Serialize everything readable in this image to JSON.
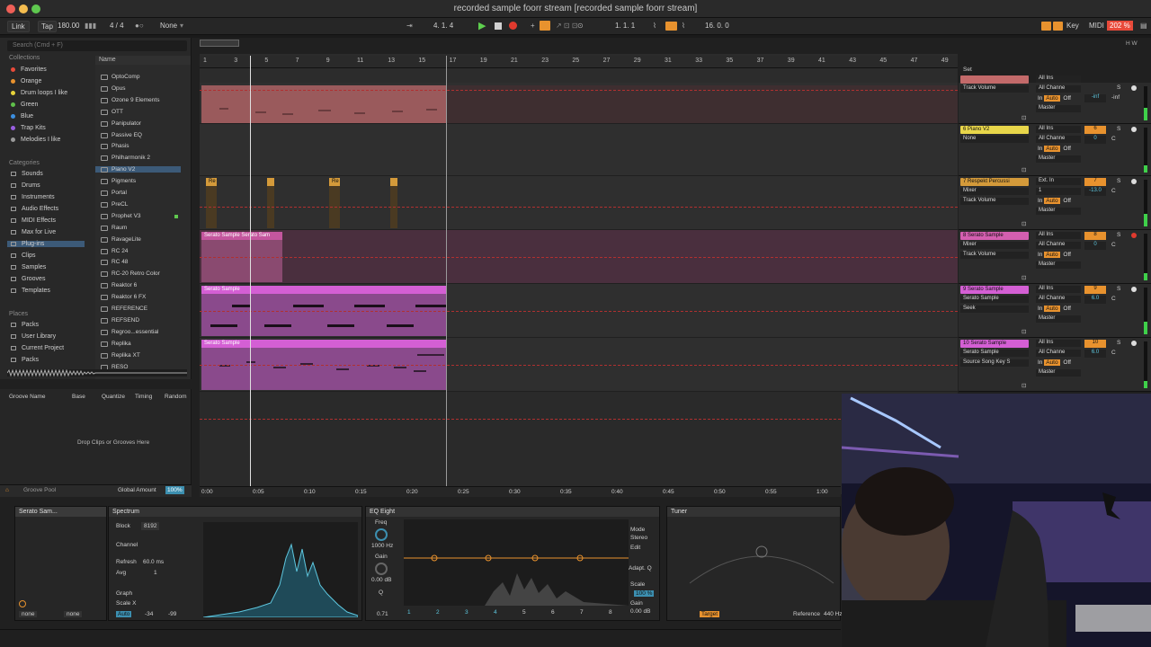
{
  "title": "recorded sample foorr stream  [recorded sample foorr stream]",
  "transport": {
    "link": "Link",
    "tap": "Tap",
    "bpm": "180.00",
    "signature": "4 / 4",
    "quantize": "None",
    "position": "4.   1.   4",
    "loop_start": "1.   1.   1",
    "loop_length": "16.   0.   0",
    "key": "Key",
    "midi": "MIDI",
    "cpu": "202 %"
  },
  "browser": {
    "search_placeholder": "Search (Cmd + F)",
    "collections_header": "Collections",
    "collections": [
      {
        "label": "Favorites",
        "color": "#e84a3a"
      },
      {
        "label": "Orange",
        "color": "#e8922e"
      },
      {
        "label": "Drum loops I like",
        "color": "#e6d23a"
      },
      {
        "label": "Green",
        "color": "#5fc04a"
      },
      {
        "label": "Blue",
        "color": "#3c8fe0"
      },
      {
        "label": "Trap Kits",
        "color": "#9a5fe0"
      },
      {
        "label": "Melodies I like",
        "color": "#9a9a9a"
      }
    ],
    "categories_header": "Categories",
    "categories": [
      "Sounds",
      "Drums",
      "Instruments",
      "Audio Effects",
      "MIDI Effects",
      "Max for Live",
      "Plug-ins",
      "Clips",
      "Samples",
      "Grooves",
      "Templates"
    ],
    "places_header": "Places",
    "places": [
      "Packs",
      "User Library",
      "Current Project",
      "Packs"
    ],
    "name_header": "Name",
    "files": [
      "OptoComp",
      "Opus",
      "Ozone 9 Elements",
      "OTT",
      "Panipulator",
      "Passive EQ",
      "Phasis",
      "Philharmonik 2",
      "Piano V2",
      "Pigments",
      "Portal",
      "PreCL",
      "Prophet V3",
      "Raum",
      "RavageLite",
      "RC 24",
      "RC 48",
      "RC-20 Retro Color",
      "Reaktor 6",
      "Reaktor 6 FX",
      "REFERENCE",
      "REFSEND",
      "Regroo...essential",
      "Replika",
      "Replika XT",
      "RESO"
    ]
  },
  "groove": {
    "name": "Groove Name",
    "base": "Base",
    "quantize": "Quantize",
    "timing": "Timing",
    "random": "Random",
    "drop_text": "Drop Clips or Grooves Here",
    "pool": "Groove Pool",
    "global_amount": "Global Amount",
    "global_value": "100%"
  },
  "ruler": [
    "1",
    "3",
    "5",
    "7",
    "9",
    "11",
    "13",
    "15",
    "17",
    "19",
    "21",
    "23",
    "25",
    "27",
    "29",
    "31",
    "33",
    "35",
    "37",
    "39",
    "41",
    "43",
    "45",
    "47",
    "49"
  ],
  "set_label": "Set",
  "clips": {
    "perc": "Re",
    "serato_long": "Serato Sample Serato Sam",
    "serato_a": "Serato Sample",
    "serato_b": "Serato Sample"
  },
  "tracks": [
    {
      "name": "",
      "sel1": "Track Volume",
      "io1": "All Ins",
      "io2": "All Channe",
      "out": "Master",
      "num": "",
      "vol": "-inf",
      "pan": "-inf",
      "name_color": "#c36a6a"
    },
    {
      "name": "6 Piano V2",
      "sel1": "None",
      "io1": "All Ins",
      "io2": "All Channe",
      "out": "Master",
      "num": "6",
      "vol": "0",
      "pan": "C",
      "name_color": "#e8d64a"
    },
    {
      "name": "7 Respekt Percussi",
      "sel1": "Mixer",
      "sel2": "Track Volume",
      "io1": "Ext. In",
      "io2": "1",
      "out": "Master",
      "num": "7",
      "vol": "-13.0",
      "pan": "C",
      "name_color": "#d49a3a"
    },
    {
      "name": "8 Serato Sample",
      "sel1": "Mixer",
      "sel2": "Track Volume",
      "io1": "All Ins",
      "io2": "All Channe",
      "out": "Master",
      "num": "8",
      "vol": "0",
      "pan": "C",
      "name_color": "#d45fb0"
    },
    {
      "name": "9 Serato Sample",
      "sel1": "Serato Sample",
      "sel2": "Seek",
      "io1": "All Ins",
      "io2": "All Channe",
      "out": "Master",
      "num": "9",
      "vol": "6.0",
      "pan": "C",
      "name_color": "#d45fd4"
    },
    {
      "name": "10 Serato Sample",
      "sel1": "Serato Sample",
      "sel2": "Source Song Key S",
      "io1": "All Ins",
      "io2": "All Channe",
      "out": "Master",
      "num": "10",
      "vol": "6.0",
      "pan": "C",
      "name_color": "#d45fd4"
    }
  ],
  "time_labels": [
    "0:00",
    "0:05",
    "0:10",
    "0:15",
    "0:20",
    "0:25",
    "0:30",
    "0:35",
    "0:40",
    "0:45",
    "0:50",
    "0:55",
    "1:00"
  ],
  "devices": {
    "serato": "Serato Sam...",
    "spectrum": "Spectrum",
    "block": "Block",
    "block_val": "8192",
    "channel": "Channel",
    "refresh": "Refresh",
    "refresh_val": "60.0 ms",
    "avg": "Avg",
    "avg_val": "1",
    "graph": "Graph",
    "scale_x": "Scale X",
    "auto": "Auto",
    "db_labels": [
      "-12",
      "-18",
      "-24",
      "-30",
      "-36",
      "-42",
      "-48",
      "-54",
      "-60",
      "-66",
      "-72",
      "-78",
      "-84",
      "-90",
      "-96"
    ],
    "freq_labels": [
      "100",
      "1k",
      "10k"
    ],
    "range": "-34",
    "range2": "-99",
    "none1": "none",
    "none2": "none",
    "eq": "EQ Eight",
    "freq": "Freq",
    "freq_val": "1000 Hz",
    "gain": "Gain",
    "gain_val": "0.00 dB",
    "q": "Q",
    "q_val": "0.71",
    "mode": "Mode",
    "mode_val": "Stereo",
    "edit": "Edit",
    "adapt_q": "Adapt. Q",
    "scale": "Scale",
    "scale_val": "100 %",
    "gain2": "Gain",
    "gain2_val": "0.00 dB",
    "bands": [
      "1",
      "2",
      "3",
      "4",
      "5",
      "6",
      "7",
      "8"
    ],
    "tuner": "Tuner",
    "target": "Target",
    "reference": "Reference",
    "reference_val": "440 Hz"
  }
}
